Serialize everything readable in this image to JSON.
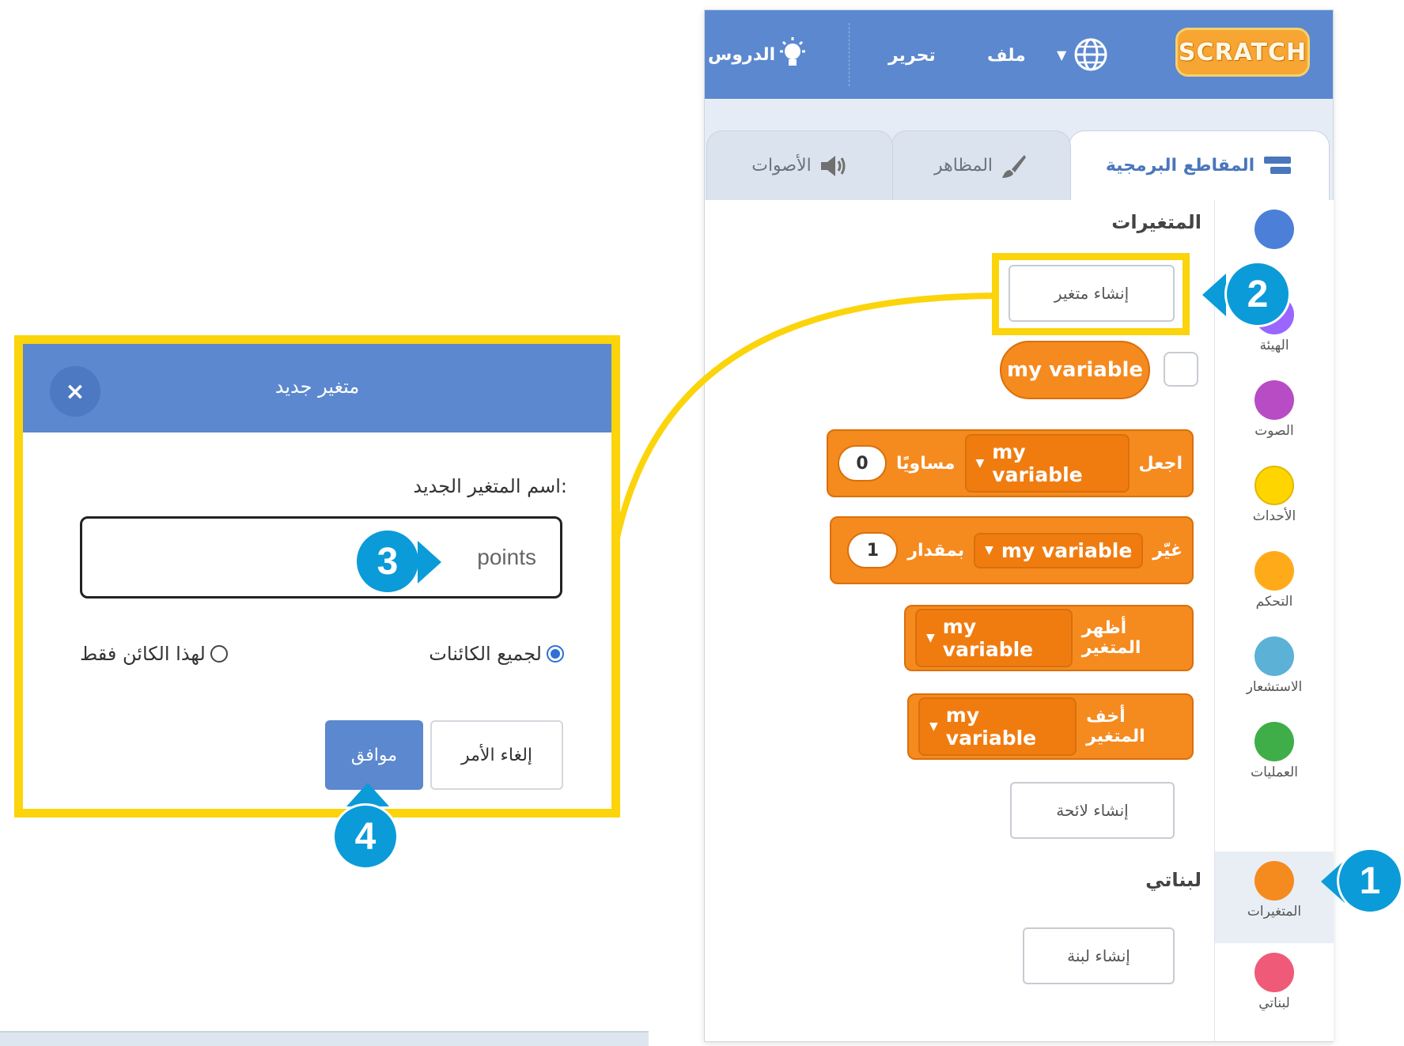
{
  "menubar": {
    "logo": "SCRATCH",
    "file": "ملف",
    "edit": "تحرير",
    "tutorials": "الدروس"
  },
  "tabs": [
    {
      "label": "المقاطع البرمجية",
      "icon": "code-blocks-icon"
    },
    {
      "label": "المظاهر",
      "icon": "brush-icon"
    },
    {
      "label": "الأصوات",
      "icon": "speaker-icon"
    }
  ],
  "categories": [
    {
      "label": "",
      "color": "#4c7fd8"
    },
    {
      "label": "الهيئة",
      "color": "#9966ff"
    },
    {
      "label": "الصوت",
      "color": "#b84cc4"
    },
    {
      "label": "الأحداث",
      "color": "#ffd500"
    },
    {
      "label": "التحكم",
      "color": "#ffab19"
    },
    {
      "label": "الاستشعار",
      "color": "#5cb1d6"
    },
    {
      "label": "العمليات",
      "color": "#3fae49"
    },
    {
      "label": "المتغيرات",
      "color": "#f58a1f"
    },
    {
      "label": "لبناتي",
      "color": "#ef5a78"
    }
  ],
  "palette": {
    "variables_title": "المتغيرات",
    "make_variable": "إنشاء متغير",
    "variable_reporter": "my variable",
    "set_block": {
      "verb": "اجعل",
      "variable": "my variable",
      "to": "مساويًا",
      "value": "0"
    },
    "change_block": {
      "verb": "غيّر",
      "variable": "my variable",
      "by": "بمقدار",
      "value": "1"
    },
    "show_block": {
      "verb": "أظهر المتغير",
      "variable": "my variable"
    },
    "hide_block": {
      "verb": "أخف المتغير",
      "variable": "my variable"
    },
    "make_list": "إنشاء لائحة",
    "my_blocks_title": "لبناتي",
    "make_block": "إنشاء لبنة"
  },
  "dialog": {
    "title": "متغير جديد",
    "close": "×",
    "name_label": "اسم المتغير الجديد:",
    "name_value": "points",
    "option_all": "لجميع الكائنات",
    "option_this": "لهذا الكائن فقط",
    "cancel": "إلغاء الأمر",
    "ok": "موافق"
  },
  "badges": [
    "1",
    "2",
    "3",
    "4"
  ],
  "colors": {
    "menubar": "#5b88cf",
    "highlight": "#fbd40b",
    "badge": "#0b9bd8",
    "variables": "#f58a1f"
  }
}
